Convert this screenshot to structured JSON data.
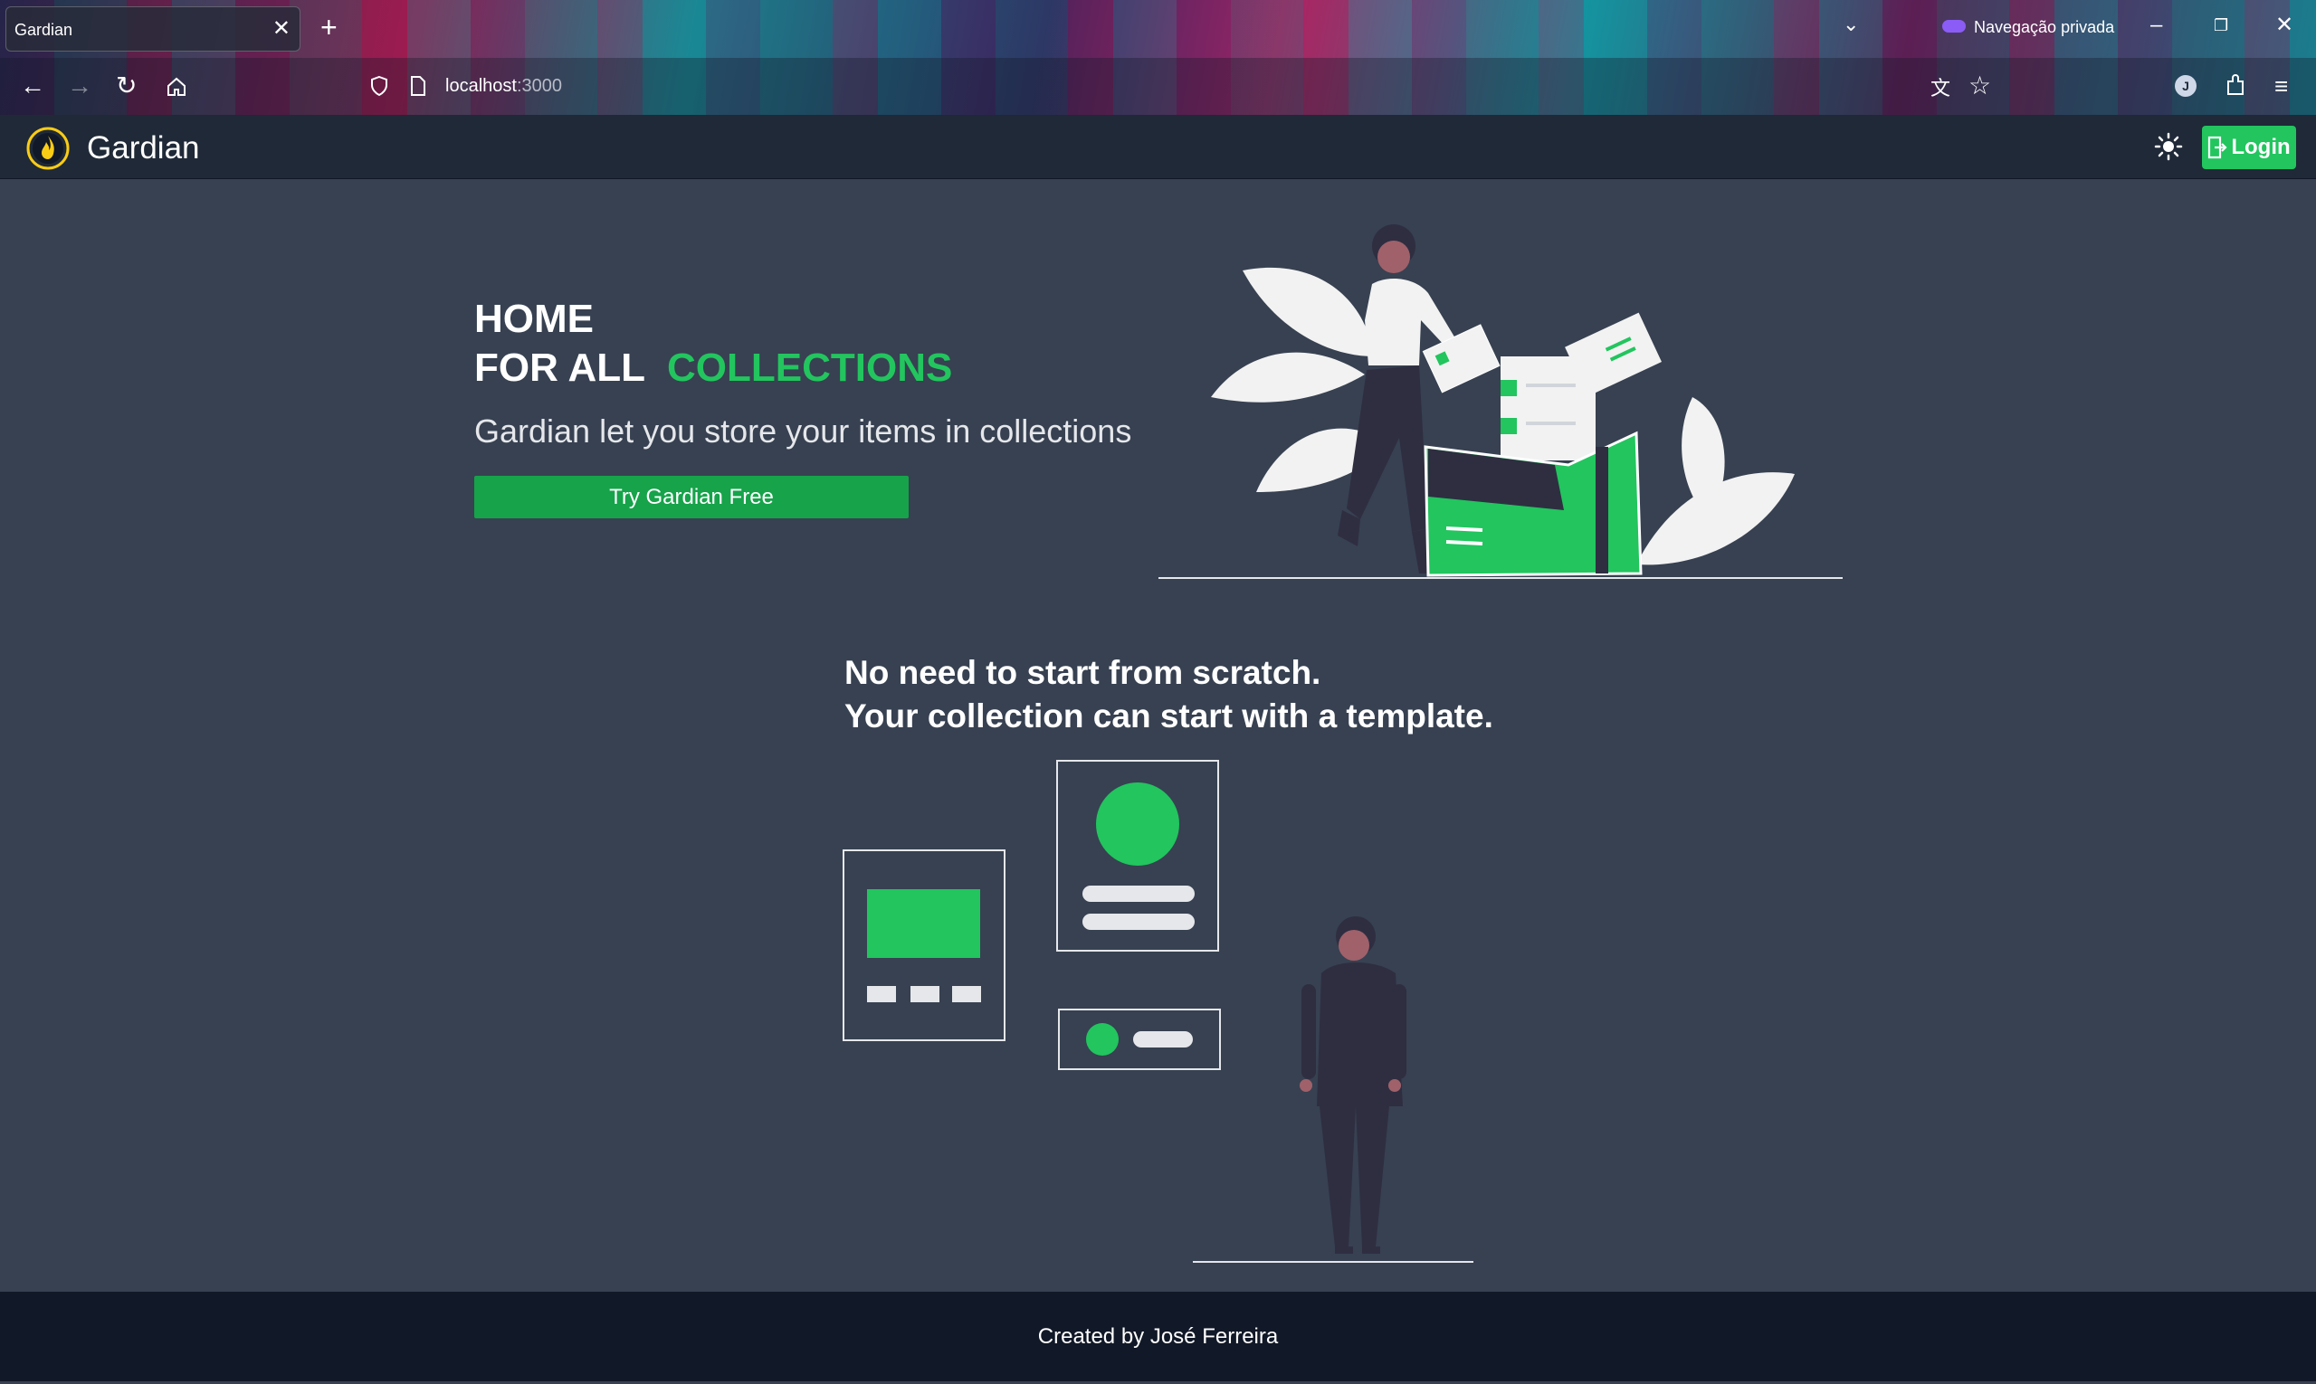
{
  "browser": {
    "tab_title": "Gardian",
    "tab_close_icon": "close-icon",
    "new_tab": "+",
    "private_label": "Navegação privada",
    "url_host": "localhost",
    "url_port": ":3000",
    "profile_initial": "J"
  },
  "header": {
    "brand": "Gardian",
    "login_label": "Login",
    "accent_color": "#22c55e"
  },
  "hero": {
    "title_line1": "HOME",
    "title_line2": "FOR ALL",
    "title_accent": "COLLECTIONS",
    "subtitle": "Gardian let you store your items in collections",
    "cta_label": "Try Gardian Free"
  },
  "templates": {
    "heading_line1": "No need to start from scratch.",
    "heading_line2": "Your collection can start with a template."
  },
  "footer": {
    "text": "Created by José Ferreira"
  }
}
